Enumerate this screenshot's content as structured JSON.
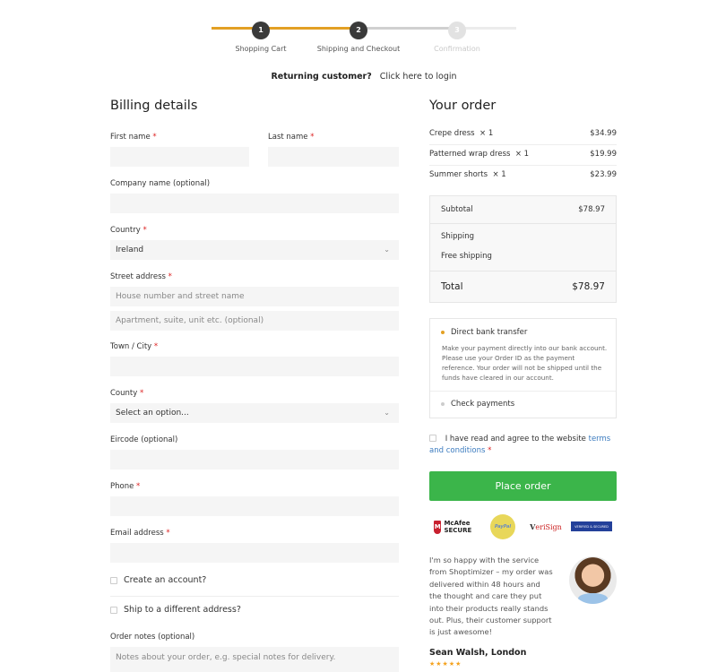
{
  "steps": [
    {
      "number": "1",
      "label": "Shopping Cart",
      "state": "done"
    },
    {
      "number": "2",
      "label": "Shipping and Checkout",
      "state": "current"
    },
    {
      "number": "3",
      "label": "Confirmation",
      "state": "upcoming"
    }
  ],
  "returning": {
    "prompt": "Returning customer?",
    "link": "Click here to login"
  },
  "billing": {
    "title": "Billing details",
    "required_mark": "*",
    "fields": {
      "first_name": {
        "label": "First name",
        "value": ""
      },
      "last_name": {
        "label": "Last name",
        "value": ""
      },
      "company": {
        "label": "Company name (optional)",
        "value": ""
      },
      "country": {
        "label": "Country",
        "value": "Ireland"
      },
      "street": {
        "label": "Street address",
        "placeholder": "House number and street name",
        "placeholder2": "Apartment, suite, unit etc. (optional)"
      },
      "town": {
        "label": "Town / City",
        "value": ""
      },
      "county": {
        "label": "County",
        "value": "Select an option..."
      },
      "eircode": {
        "label": "Eircode (optional)",
        "value": ""
      },
      "phone": {
        "label": "Phone",
        "value": ""
      },
      "email": {
        "label": "Email address",
        "value": ""
      }
    },
    "create_account": "Create an account?",
    "ship_different": "Ship to a different address?",
    "order_notes": {
      "label": "Order notes (optional)",
      "placeholder": "Notes about your order, e.g. special notes for delivery."
    }
  },
  "order": {
    "title": "Your order",
    "items": [
      {
        "name": "Crepe dress",
        "qty": "× 1",
        "price": "$34.99"
      },
      {
        "name": "Patterned wrap dress",
        "qty": "× 1",
        "price": "$19.99"
      },
      {
        "name": "Summer shorts",
        "qty": "× 1",
        "price": "$23.99"
      }
    ],
    "subtotal_label": "Subtotal",
    "subtotal": "$78.97",
    "shipping_label": "Shipping",
    "shipping_value": "Free shipping",
    "total_label": "Total",
    "total": "$78.97",
    "payment_methods": [
      {
        "label": "Direct bank transfer",
        "selected": true,
        "description": "Make your payment directly into our bank account. Please use your Order ID as the payment reference. Your order will not be shipped until the funds have cleared in our account."
      },
      {
        "label": "Check payments",
        "selected": false
      }
    ],
    "terms_text": "I have read and agree to the website",
    "terms_link": "terms and conditions",
    "place_order": "Place order",
    "badges": {
      "mcafee_icon": "M",
      "mcafee": "McAfee SECURE",
      "paypal": "PayPal",
      "verisign_v": "V",
      "verisign": "eriSign",
      "secure": "VERIFIED & SECURED"
    },
    "testimonial": {
      "quote": "I'm so happy with the service from Shoptimizer – my order was delivered within 48 hours and the thought and care they put into their products really stands out. Plus, their customer support is just awesome!",
      "author": "Sean Walsh, London",
      "rating": 5,
      "stars": "★★★★★"
    }
  },
  "colors": {
    "accent": "#e3a024",
    "button": "#3bb54a",
    "link": "#3b7bbf",
    "required": "#dd2222"
  }
}
